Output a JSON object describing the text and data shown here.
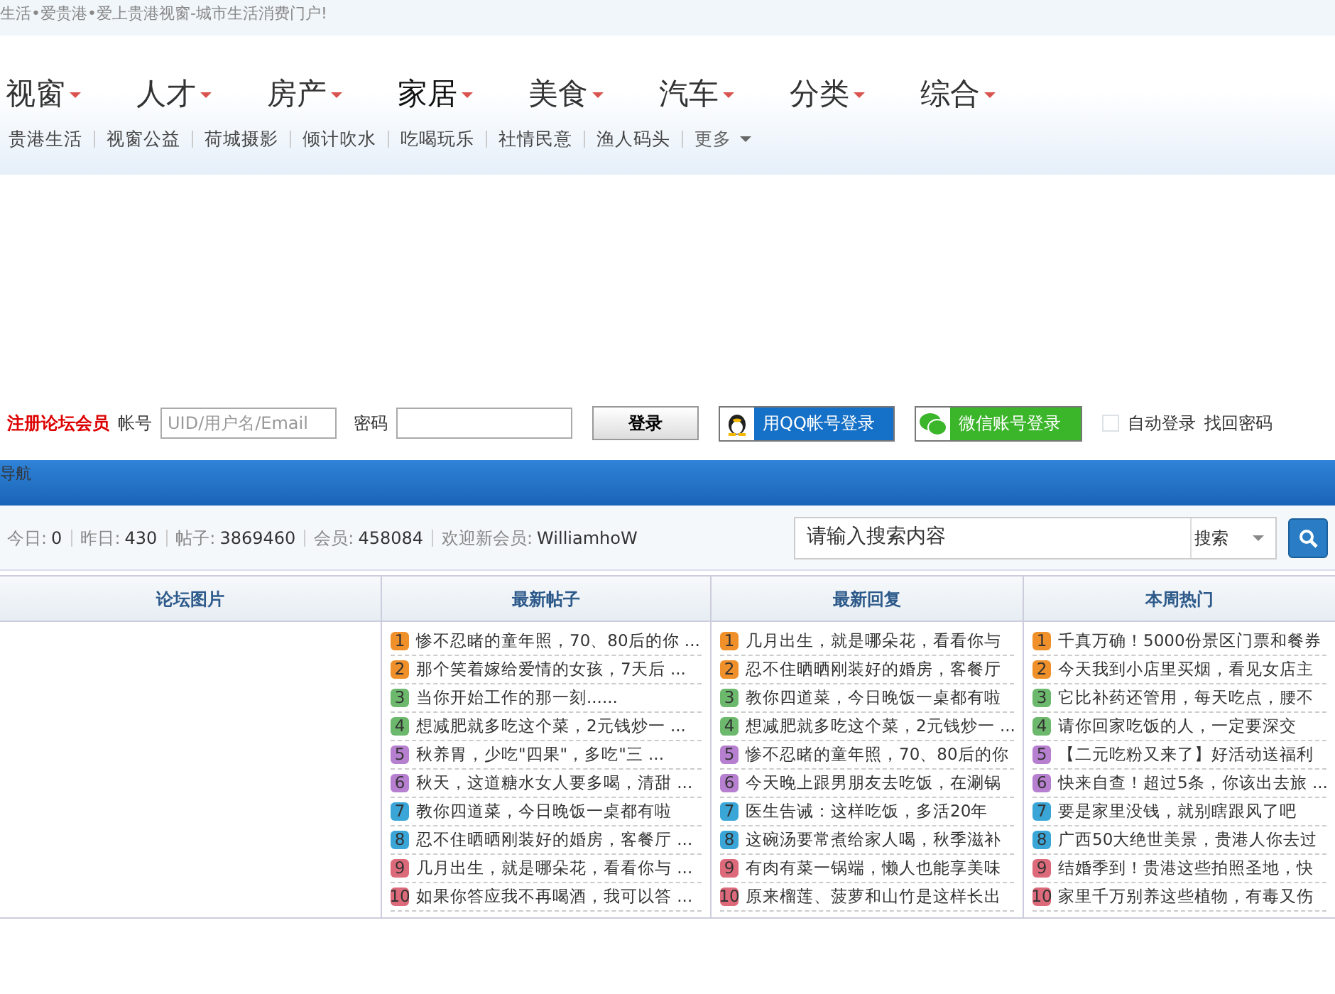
{
  "tagline": "生活•爱贵港•爱上贵港视窗-城市生活消费门户!",
  "main_nav": [
    {
      "label": "视窗",
      "selected": false
    },
    {
      "label": "人才",
      "selected": false
    },
    {
      "label": "房产",
      "selected": false
    },
    {
      "label": "家居",
      "selected": true
    },
    {
      "label": "美食",
      "selected": false
    },
    {
      "label": "汽车",
      "selected": false
    },
    {
      "label": "分类",
      "selected": false
    },
    {
      "label": "综合",
      "selected": false
    }
  ],
  "sub_nav": [
    "贵港生活",
    "视窗公益",
    "荷城摄影",
    "倾计吹水",
    "吃喝玩乐",
    "社情民意",
    "渔人码头"
  ],
  "sub_nav_more": "更多",
  "login": {
    "register": "注册论坛会员",
    "account_label": "帐号",
    "account_placeholder": "UID/用户名/Email",
    "password_label": "密码",
    "login_button": "登录",
    "qq_button": "用QQ帐号登录",
    "wechat_button": "微信账号登录",
    "auto_login": {
      "label": "自动登录",
      "checked": false
    },
    "forgot": "找回密码"
  },
  "nav_bar": {
    "title": "导航"
  },
  "stats": [
    {
      "label": "今日:",
      "value": "0"
    },
    {
      "label": "昨日:",
      "value": "430"
    },
    {
      "label": "帖子:",
      "value": "3869460"
    },
    {
      "label": "会员:",
      "value": "458084"
    },
    {
      "label": "欢迎新会员:",
      "value": "WilliamhoW"
    }
  ],
  "search": {
    "placeholder": "请输入搜索内容",
    "scope": "搜索"
  },
  "panels": [
    {
      "title": "论坛图片"
    },
    {
      "title": "最新帖子",
      "items": [
        {
          "rank": "1",
          "color": "#f0902a",
          "text": "惨不忍睹的童年照，70、80后的你 ..."
        },
        {
          "rank": "2",
          "color": "#f0902a",
          "text": "那个笑着嫁给爱情的女孩，7天后 ..."
        },
        {
          "rank": "3",
          "color": "#6cb86c",
          "text": "当你开始工作的那一刻......"
        },
        {
          "rank": "4",
          "color": "#6cb86c",
          "text": "想减肥就多吃这个菜，2元钱炒一 ..."
        },
        {
          "rank": "5",
          "color": "#b67fcf",
          "text": "秋养胃，少吃\"四果\"，多吃\"三 ..."
        },
        {
          "rank": "6",
          "color": "#b67fcf",
          "text": "秋天，这道糖水女人要多喝，清甜 ..."
        },
        {
          "rank": "7",
          "color": "#3aa6d8",
          "text": "教你四道菜，今日晚饭一桌都有啦"
        },
        {
          "rank": "8",
          "color": "#3aa6d8",
          "text": "忍不住晒晒刚装好的婚房，客餐厅 ..."
        },
        {
          "rank": "9",
          "color": "#dd6a7a",
          "text": "几月出生，就是哪朵花，看看你与 ..."
        },
        {
          "rank": "10",
          "color": "#dd6a7a",
          "text": "如果你答应我不再喝酒，我可以答 ..."
        }
      ]
    },
    {
      "title": "最新回复",
      "items": [
        {
          "rank": "1",
          "color": "#f0902a",
          "text": "几月出生，就是哪朵花，看看你与"
        },
        {
          "rank": "2",
          "color": "#f0902a",
          "text": "忍不住晒晒刚装好的婚房，客餐厅"
        },
        {
          "rank": "3",
          "color": "#6cb86c",
          "text": "教你四道菜，今日晚饭一桌都有啦"
        },
        {
          "rank": "4",
          "color": "#6cb86c",
          "text": "想减肥就多吃这个菜，2元钱炒一 ..."
        },
        {
          "rank": "5",
          "color": "#b67fcf",
          "text": "惨不忍睹的童年照，70、80后的你"
        },
        {
          "rank": "6",
          "color": "#b67fcf",
          "text": "今天晚上跟男朋友去吃饭，在涮锅"
        },
        {
          "rank": "7",
          "color": "#3aa6d8",
          "text": "医生告诫：这样吃饭，多活20年"
        },
        {
          "rank": "8",
          "color": "#3aa6d8",
          "text": "这碗汤要常煮给家人喝，秋季滋补"
        },
        {
          "rank": "9",
          "color": "#dd6a7a",
          "text": "有肉有菜一锅端，懒人也能享美味"
        },
        {
          "rank": "10",
          "color": "#dd6a7a",
          "text": "原来榴莲、菠萝和山竹是这样长出"
        }
      ]
    },
    {
      "title": "本周热门",
      "items": [
        {
          "rank": "1",
          "color": "#f0902a",
          "text": "千真万确！5000份景区门票和餐券"
        },
        {
          "rank": "2",
          "color": "#f0902a",
          "text": "今天我到小店里买烟，看见女店主"
        },
        {
          "rank": "3",
          "color": "#6cb86c",
          "text": "它比补药还管用，每天吃点，腰不"
        },
        {
          "rank": "4",
          "color": "#6cb86c",
          "text": "请你回家吃饭的人，一定要深交"
        },
        {
          "rank": "5",
          "color": "#b67fcf",
          "text": "【二元吃粉又来了】好活动送福利"
        },
        {
          "rank": "6",
          "color": "#b67fcf",
          "text": "快来自查！超过5条，你该出去旅 ..."
        },
        {
          "rank": "7",
          "color": "#3aa6d8",
          "text": "要是家里没钱，就别瞎跟风了吧"
        },
        {
          "rank": "8",
          "color": "#3aa6d8",
          "text": "广西50大绝世美景，贵港人你去过"
        },
        {
          "rank": "9",
          "color": "#dd6a7a",
          "text": "结婚季到！贵港这些拍照圣地，快"
        },
        {
          "rank": "10",
          "color": "#dd6a7a",
          "text": "家里千万别养这些植物，有毒又伤"
        }
      ]
    }
  ]
}
